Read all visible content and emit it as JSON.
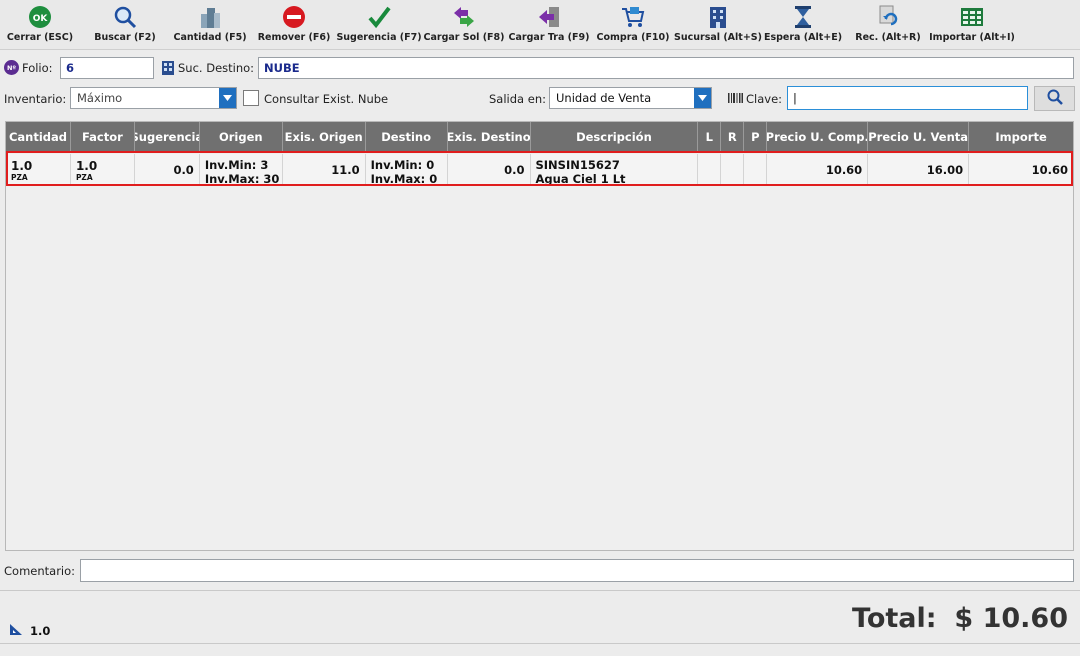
{
  "toolbar": [
    {
      "name": "ok-icon",
      "label": "Cerrar (ESC)"
    },
    {
      "name": "search-icon",
      "label": "Buscar (F2)"
    },
    {
      "name": "buildings-icon",
      "label": "Cantidad (F5)"
    },
    {
      "name": "remove-icon",
      "label": "Remover (F6)"
    },
    {
      "name": "check-icon",
      "label": "Sugerencia (F7)"
    },
    {
      "name": "exchange-arrows-icon",
      "label": "Cargar Sol (F8)"
    },
    {
      "name": "door-arrow-icon",
      "label": "Cargar Tra (F9)"
    },
    {
      "name": "cart-icon",
      "label": "Compra (F10)"
    },
    {
      "name": "building-icon",
      "label": "Sucursal (Alt+S)"
    },
    {
      "name": "hourglass-icon",
      "label": "Espera (Alt+E)"
    },
    {
      "name": "document-undo-icon",
      "label": "Rec. (Alt+R)"
    },
    {
      "name": "spreadsheet-icon",
      "label": "Importar (Alt+I)"
    }
  ],
  "form": {
    "folio_badge": "Nº",
    "folio_label": "Folio:",
    "folio_value": "6",
    "suc_label": "Suc. Destino:",
    "suc_value": "NUBE",
    "inventario_label": "Inventario:",
    "inventario_value": "Máximo",
    "consultar_label": "Consultar Exist. Nube",
    "salida_label": "Salida en:",
    "salida_value": "Unidad de Venta",
    "clave_label": "Clave:",
    "clave_value": "|",
    "comentario_label": "Comentario:",
    "comentario_value": ""
  },
  "table": {
    "columns": [
      "Cantidad",
      "Factor",
      "Sugerencia",
      "Origen",
      "Exis. Origen",
      "Destino",
      "Exis. Destino",
      "Descripción",
      "L",
      "R",
      "P",
      "Precio U. Comp.",
      "Precio U. Venta",
      "Importe"
    ],
    "rows": [
      {
        "cantidad": "1.0",
        "cantidad_unit": "PZA",
        "factor": "1.0",
        "factor_unit": "PZA",
        "sugerencia": "0.0",
        "origen_min": "Inv.Min: 3",
        "origen_max": "Inv.Max: 30",
        "exis_origen": "11.0",
        "destino_min": "Inv.Min: 0",
        "destino_max": "Inv.Max: 0",
        "exis_destino": "0.0",
        "clave": "SINSIN15627",
        "descripcion": "Agua Ciel 1 Lt",
        "l": "",
        "r": "",
        "p": "",
        "precio_comp": "10.60",
        "precio_venta": "16.00",
        "importe": "10.60"
      }
    ]
  },
  "footer": {
    "count": "1.0",
    "total_label": "Total:",
    "total_value": "$ 10.60"
  },
  "colors": {
    "header_bg": "#707070",
    "selection": "#e01d1d",
    "accent_blue": "#1f6fbf"
  }
}
